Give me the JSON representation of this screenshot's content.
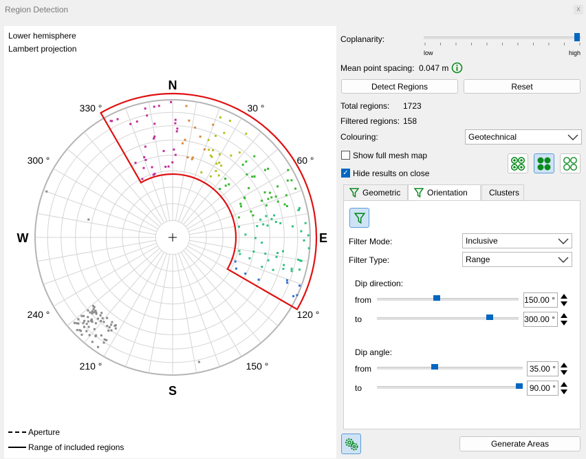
{
  "window": {
    "title": "Region Detection",
    "close_glyph": "x"
  },
  "plot": {
    "caption_line1": "Lower hemisphere",
    "caption_line2": "Lambert projection",
    "compass": {
      "n": "N",
      "e": "E",
      "s": "S",
      "w": "W"
    },
    "angle_labels": [
      "30 °",
      "60 °",
      "120 °",
      "150 °",
      "210 °",
      "240 °",
      "300 °",
      "330 °"
    ],
    "legend": {
      "aperture": "Aperture",
      "range": "Range of included regions"
    },
    "colors": {
      "range_outline": "#e01010",
      "grid": "#d0d0d0",
      "outer_circle": "#b4b4b4"
    }
  },
  "controls": {
    "coplanarity_label": "Coplanarity:",
    "coplanarity_low": "low",
    "coplanarity_high": "high",
    "coplanarity_level": 1.0,
    "mean_spacing_label": "Mean point spacing:",
    "mean_spacing_value": "0.047 m",
    "detect_button": "Detect Regions",
    "reset_button": "Reset",
    "total_regions_label": "Total regions:",
    "total_regions_value": "1723",
    "filtered_regions_label": "Filtered regions:",
    "filtered_regions_value": "158",
    "colouring_label": "Colouring:",
    "colouring_value": "Geotechnical",
    "show_mesh_label": "Show full mesh map",
    "show_mesh_checked": false,
    "hide_results_label": "Hide results on close",
    "hide_results_checked": true
  },
  "tabs": [
    {
      "label": "Geometric",
      "active": false
    },
    {
      "label": "Orientation",
      "active": true
    },
    {
      "label": "Clusters",
      "active": false
    }
  ],
  "orientation": {
    "filter_mode_label": "Filter Mode:",
    "filter_mode_value": "Inclusive",
    "filter_type_label": "Filter Type:",
    "filter_type_value": "Range",
    "dip_direction_label": "Dip direction:",
    "dip_angle_label": "Dip angle:",
    "from_label": "from",
    "to_label": "to",
    "dip_direction_from": "150.00 °",
    "dip_direction_to": "300.00 °",
    "dip_angle_from": "35.00 °",
    "dip_angle_to": "90.00 °",
    "dip_direction_from_level": 0.42,
    "dip_direction_to_level": 0.81,
    "dip_angle_from_level": 0.39,
    "dip_angle_to_level": 1.0
  },
  "footer": {
    "generate_button": "Generate Areas"
  },
  "accent": "#0067c0",
  "icon_green": "#0a8a1e"
}
